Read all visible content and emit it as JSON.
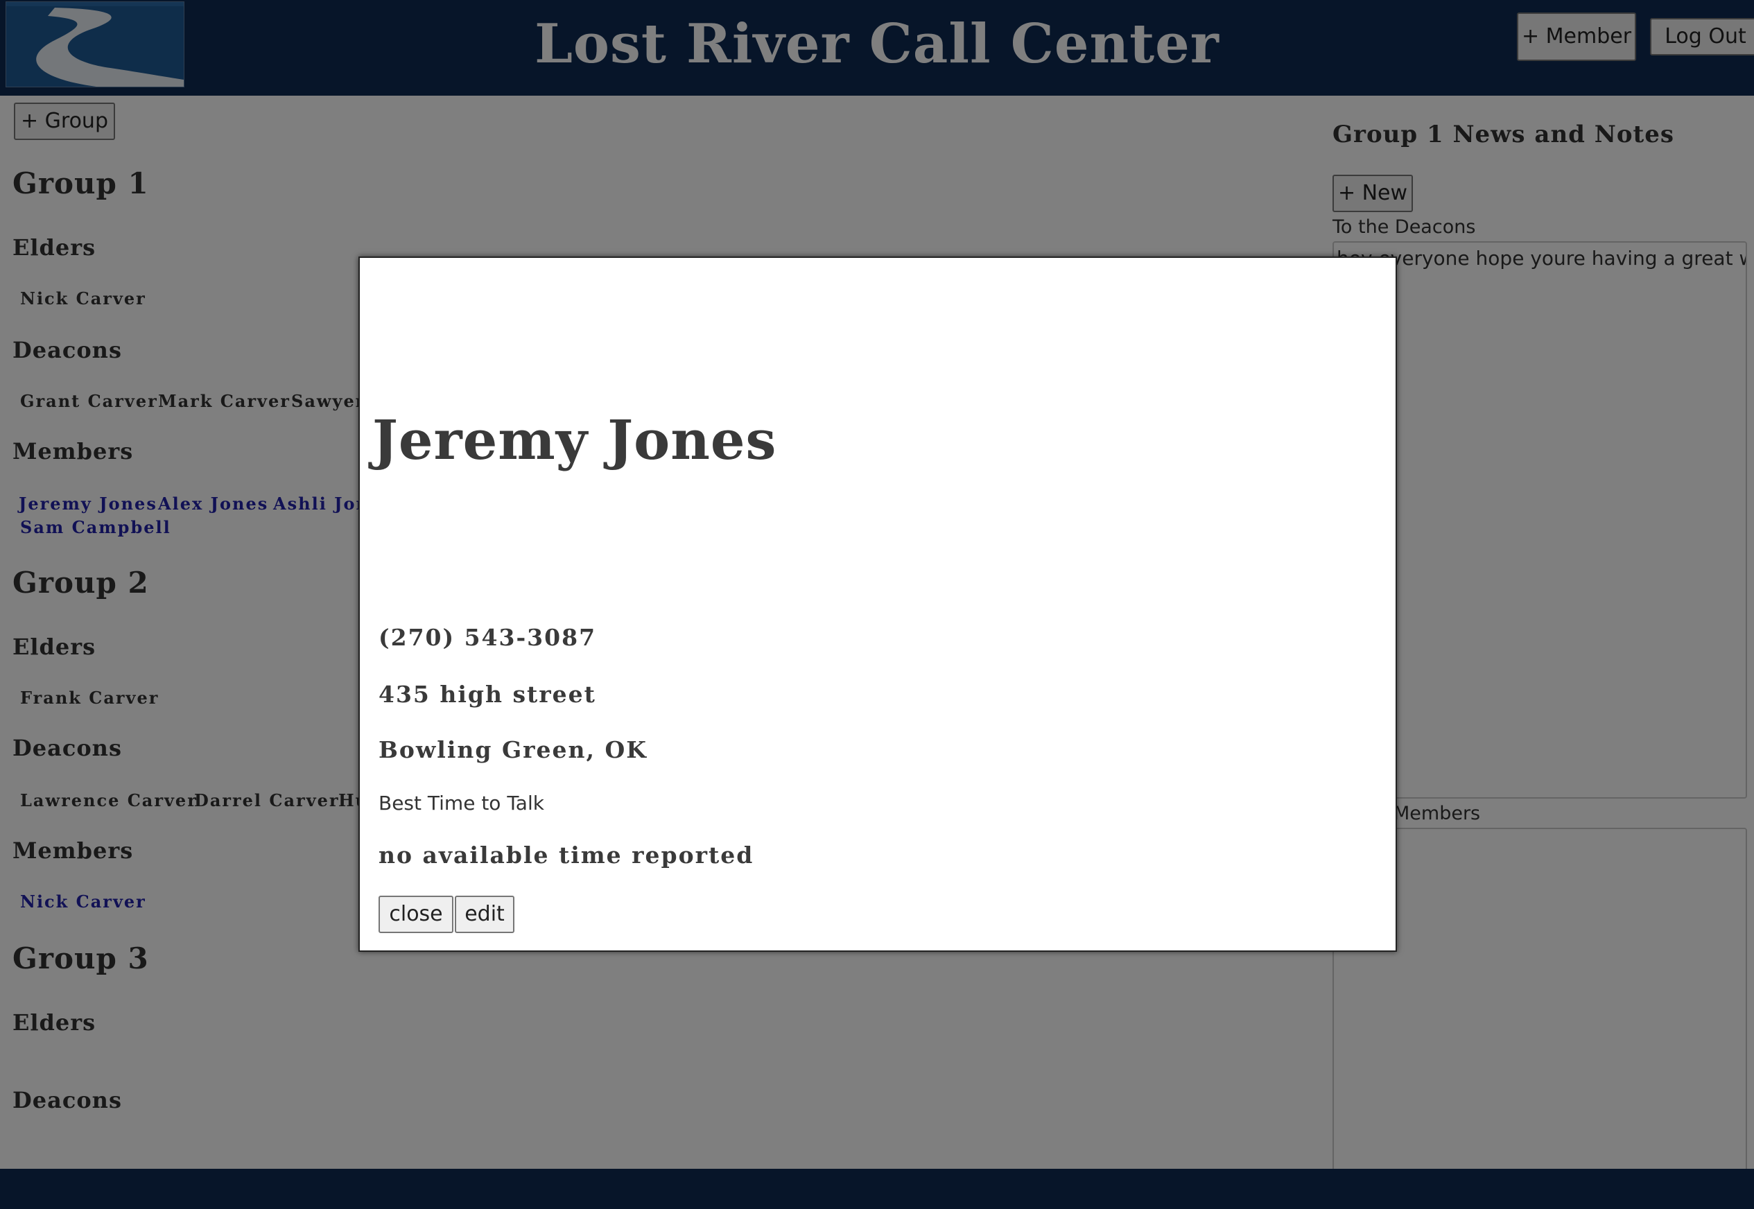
{
  "header": {
    "title": "Lost River Call Center",
    "member_button": "+ Member",
    "logout_button": "Log Out",
    "logo_icon": "river-logo-icon"
  },
  "toolbar": {
    "add_group_button": "+ Group"
  },
  "groups": [
    {
      "title": "Group 1",
      "elders_label": "Elders",
      "elders": [
        "Nick Carver"
      ],
      "deacons_label": "Deacons",
      "deacons": [
        "Grant Carver",
        "Mark Carver",
        "Sawyer"
      ],
      "members_label": "Members",
      "members": [
        "Jeremy Jones",
        "Alex Jones",
        "Ashli Jon",
        "Sam Campbell"
      ]
    },
    {
      "title": "Group 2",
      "elders_label": "Elders",
      "elders": [
        "Frank Carver"
      ],
      "deacons_label": "Deacons",
      "deacons": [
        "Lawrence Carver",
        "Darrel Carver",
        "Hu"
      ],
      "members_label": "Members",
      "members": [
        "Nick Carver"
      ]
    },
    {
      "title": "Group 3",
      "elders_label": "Elders",
      "deacons_label": "Deacons"
    }
  ],
  "sidebar": {
    "title": "Group 1 News and Notes",
    "new_button": "+ New",
    "notes_label": "To the Deacons",
    "notes_text": "hey everyone hope youre having a great week",
    "members_label": "Members"
  },
  "modal": {
    "name": "Jeremy Jones",
    "phone": "(270) 543-3087",
    "street": "435 high street",
    "city": "Bowling Green, OK",
    "best_time_label": "Best Time to Talk",
    "best_time": "no available time reported",
    "close_button": "close",
    "edit_button": "edit"
  },
  "colors": {
    "header_bg": "#0e2b52",
    "link": "#2222aa",
    "overlay": "rgba(0,0,0,0.5)"
  }
}
